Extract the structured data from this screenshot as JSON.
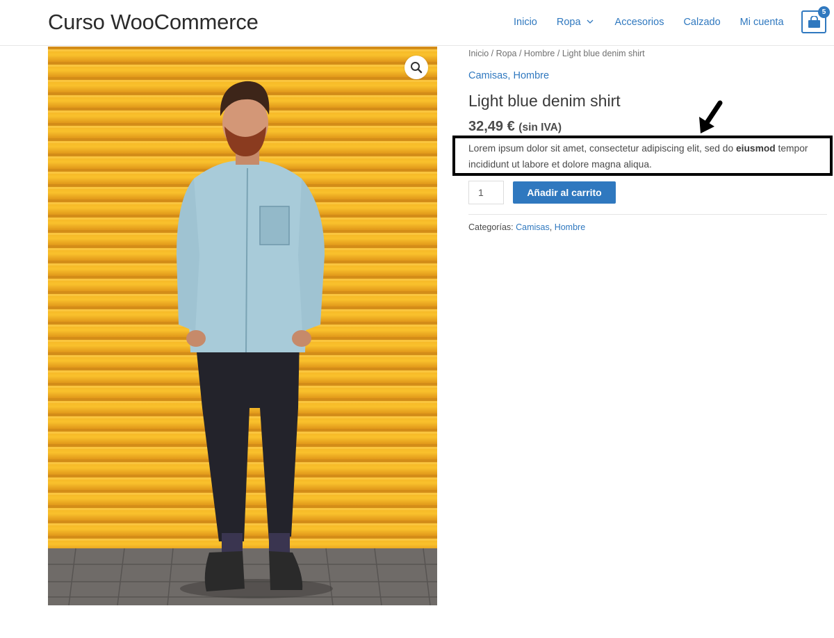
{
  "site": {
    "title": "Curso WooCommerce"
  },
  "nav": {
    "items": [
      {
        "label": "Inicio"
      },
      {
        "label": "Ropa",
        "has_submenu": true
      },
      {
        "label": "Accesorios"
      },
      {
        "label": "Calzado"
      },
      {
        "label": "Mi cuenta"
      }
    ]
  },
  "cart": {
    "count": "5",
    "icon": "shopping-bag-icon"
  },
  "breadcrumb": {
    "items": [
      "Inicio",
      "Ropa",
      "Hombre"
    ],
    "current": "Light blue denim shirt",
    "separator": " / "
  },
  "product": {
    "categories_top": [
      "Camisas",
      "Hombre"
    ],
    "title": "Light blue denim shirt",
    "price": "32,49 €",
    "price_suffix": "(sin IVA)",
    "description_part1": "Lorem ipsum dolor sit amet, consectetur adipiscing elit, sed do ",
    "description_bold": "eiusmod",
    "description_part2": " tempor incididunt ut labore et dolore magna aliqua.",
    "quantity": "1",
    "add_to_cart_label": "Añadir al carrito",
    "meta_label": "Categorías:",
    "meta_categories": [
      "Camisas",
      "Hombre"
    ]
  },
  "colors": {
    "accent": "#2f78bf",
    "image_background": "#f0a920",
    "highlight_border": "#000000"
  },
  "icons": {
    "zoom": "magnifier-icon",
    "chevron": "chevron-down-icon",
    "annotation": "arrow-down-left-icon"
  }
}
